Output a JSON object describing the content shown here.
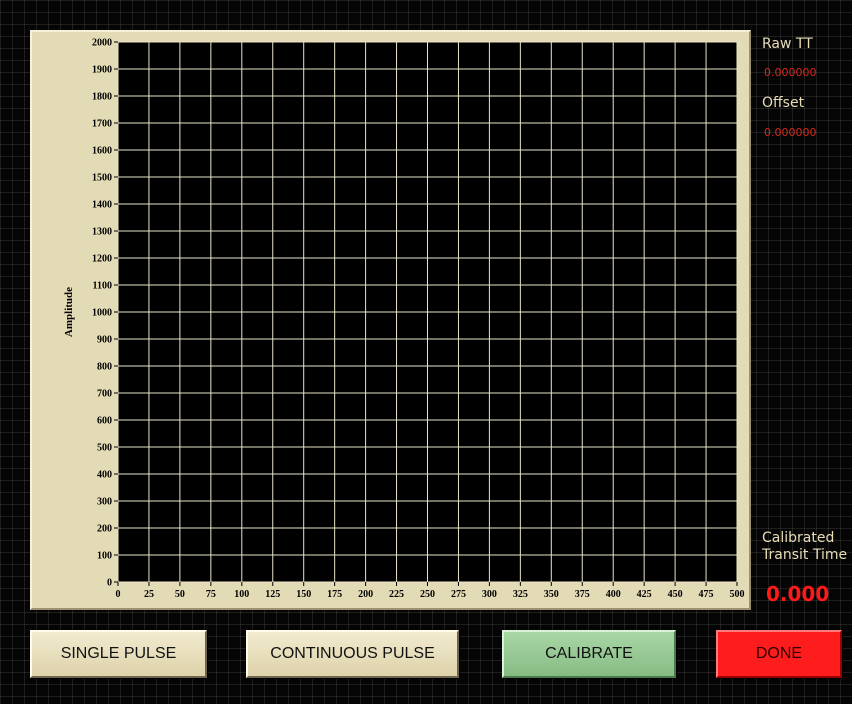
{
  "indicators": {
    "raw_tt_label": "Raw TT",
    "raw_tt_value": "0.000000",
    "offset_label": "Offset",
    "offset_value": "0.000000",
    "calibrated_label_line1": "Calibrated",
    "calibrated_label_line2": "Transit Time",
    "calibrated_value": "0.000"
  },
  "buttons": {
    "single_pulse": "SINGLE PULSE",
    "continuous_pulse": "CONTINUOUS PULSE",
    "calibrate": "CALIBRATE",
    "done": "DONE"
  },
  "colors": {
    "plot_background": "#000000",
    "grid": "#e9e4c8",
    "graph_frame": "#e3dab6",
    "indicator_value": "#d42a1e",
    "calibrated_value": "#ff1a1a",
    "calibrate_button": "#9ccc98",
    "done_button": "#ff1c1c"
  },
  "chart_data": {
    "type": "line",
    "title": "",
    "xlabel": "",
    "ylabel": "Amplitude",
    "xlim": [
      0,
      500
    ],
    "ylim": [
      0,
      2000
    ],
    "x_ticks": [
      0,
      25,
      50,
      75,
      100,
      125,
      150,
      175,
      200,
      225,
      250,
      275,
      300,
      325,
      350,
      375,
      400,
      425,
      450,
      475,
      500
    ],
    "y_ticks": [
      0,
      100,
      200,
      300,
      400,
      500,
      600,
      700,
      800,
      900,
      1000,
      1100,
      1200,
      1300,
      1400,
      1500,
      1600,
      1700,
      1800,
      1900,
      2000
    ],
    "grid": true,
    "series": []
  }
}
